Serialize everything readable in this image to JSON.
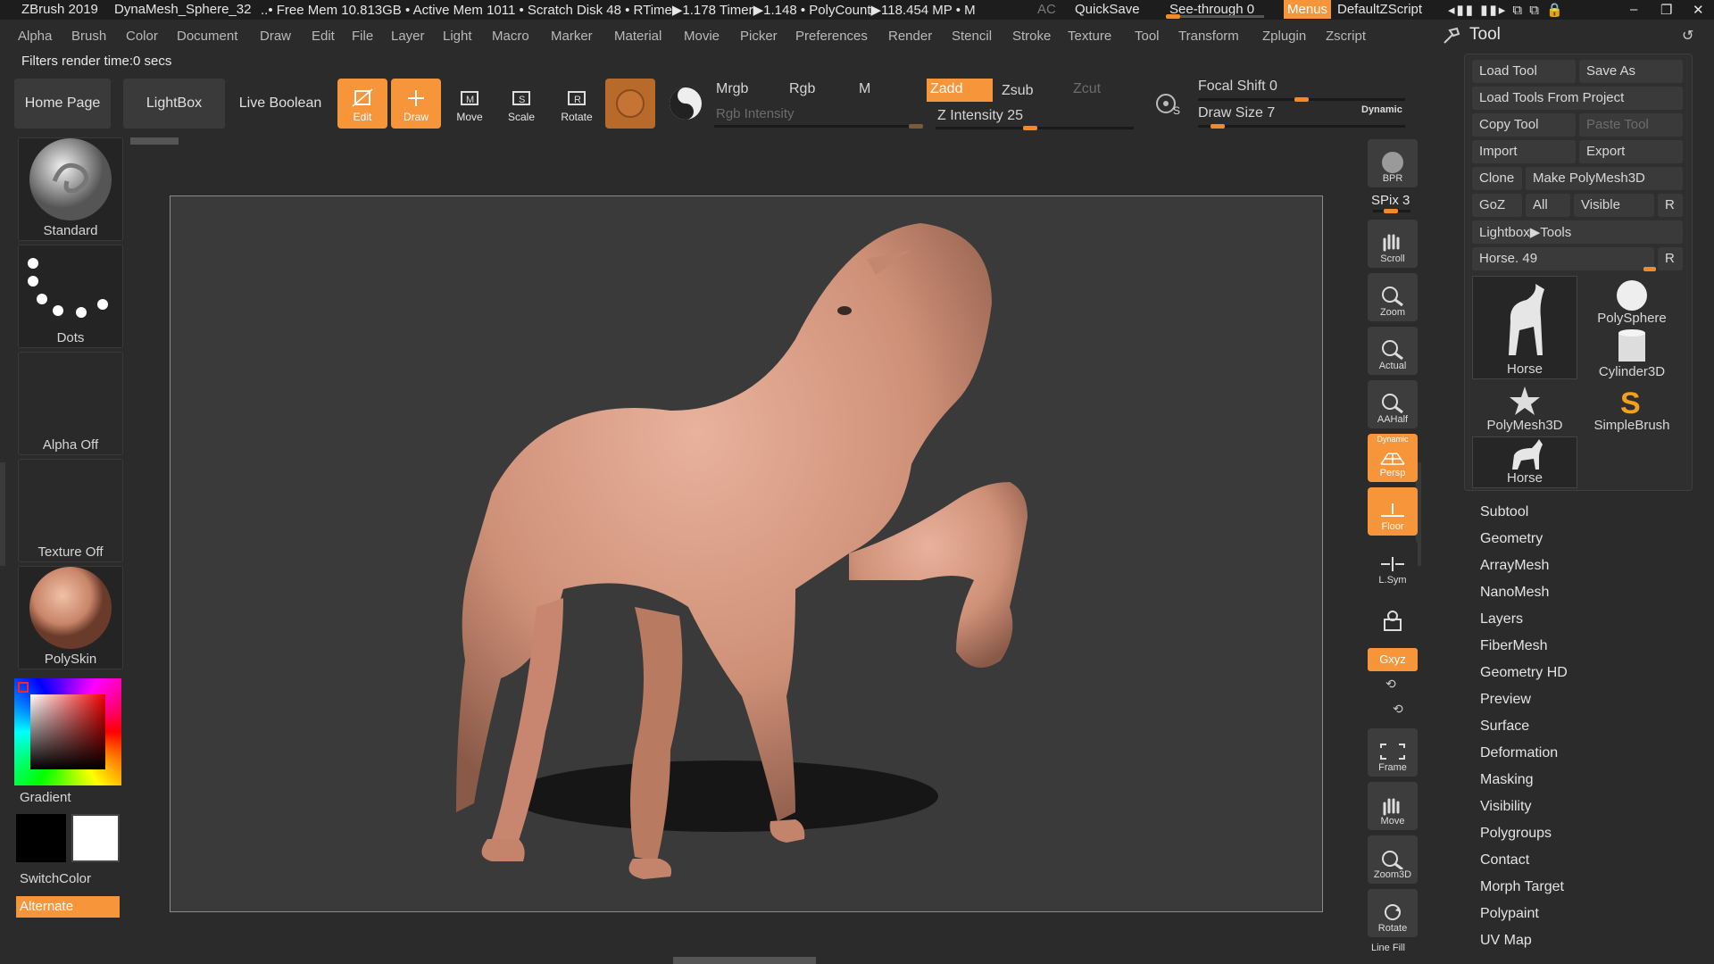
{
  "titlebar": {
    "app": "ZBrush 2019",
    "document": "DynaMesh_Sphere_32",
    "stats": "..• Free Mem 10.813GB • Active Mem 1011 • Scratch Disk 48 •  RTime▶1.178 Timer▶1.148 • PolyCount▶118.454 MP  • M",
    "ac": "AC",
    "quicksave": "QuickSave",
    "see_through": "See-through  0",
    "menus": "Menus",
    "script": "DefaultZScript"
  },
  "menubar": [
    "Alpha",
    "Brush",
    "Color",
    "Document",
    "Draw",
    "Edit",
    "File",
    "Layer",
    "Light",
    "Macro",
    "Marker",
    "Material",
    "Movie",
    "Picker",
    "Preferences",
    "Render",
    "Stencil",
    "Stroke",
    "Texture",
    "Tool",
    "Transform",
    "Zplugin",
    "Zscript"
  ],
  "status": "Filters render time:0 secs",
  "shelf": {
    "home": "Home Page",
    "lightbox": "LightBox",
    "liveboolean": "Live Boolean",
    "edit": "Edit",
    "draw": "Draw",
    "move": "Move",
    "scale": "Scale",
    "rotate": "Rotate",
    "mrgb": "Mrgb",
    "rgb": "Rgb",
    "m": "M",
    "zadd": "Zadd",
    "zsub": "Zsub",
    "zcut": "Zcut",
    "rgb_intensity": "Rgb Intensity",
    "z_intensity": "Z Intensity 25",
    "focal_shift": "Focal Shift 0",
    "draw_size": "Draw Size 7",
    "dynamic": "Dynamic"
  },
  "left": {
    "brush": "Standard",
    "stroke": "Dots",
    "alpha": "Alpha Off",
    "texture": "Texture Off",
    "material": "PolySkin",
    "gradient": "Gradient",
    "switchcolor": "SwitchColor",
    "alternate": "Alternate"
  },
  "right_icons": {
    "bpr": "BPR",
    "spix": "SPix 3",
    "scroll": "Scroll",
    "zoom": "Zoom",
    "actual": "Actual",
    "aahalf": "AAHalf",
    "persp_top": "Dynamic",
    "persp": "Persp",
    "floor": "Floor",
    "lsym": "L.Sym",
    "xyz": "Gxyz",
    "frame": "Frame",
    "move": "Move",
    "zoom3d": "Zoom3D",
    "rotate": "Rotate",
    "linefill": "Line Fill"
  },
  "tool": {
    "title": "Tool",
    "load_tool": "Load Tool",
    "save_as": "Save As",
    "load_from_project": "Load Tools From Project",
    "copy_tool": "Copy Tool",
    "paste_tool": "Paste Tool",
    "import": "Import",
    "export": "Export",
    "clone": "Clone",
    "make_polymesh": "Make PolyMesh3D",
    "goz": "GoZ",
    "all": "All",
    "visible": "Visible",
    "r": "R",
    "lightbox_tools": "Lightbox▶Tools",
    "current": "Horse. 49",
    "items": [
      "Horse",
      "PolySphere",
      "Cylinder3D",
      "PolyMesh3D",
      "SimpleBrush",
      "Horse"
    ]
  },
  "subpalettes": [
    "Subtool",
    "Geometry",
    "ArrayMesh",
    "NanoMesh",
    "Layers",
    "FiberMesh",
    "Geometry HD",
    "Preview",
    "Surface",
    "Deformation",
    "Masking",
    "Visibility",
    "Polygroups",
    "Contact",
    "Morph Target",
    "Polypaint",
    "UV Map"
  ],
  "colors": {
    "accent": "#f7953b",
    "skin": "#d99a82",
    "bg": "#2b2b2b"
  }
}
